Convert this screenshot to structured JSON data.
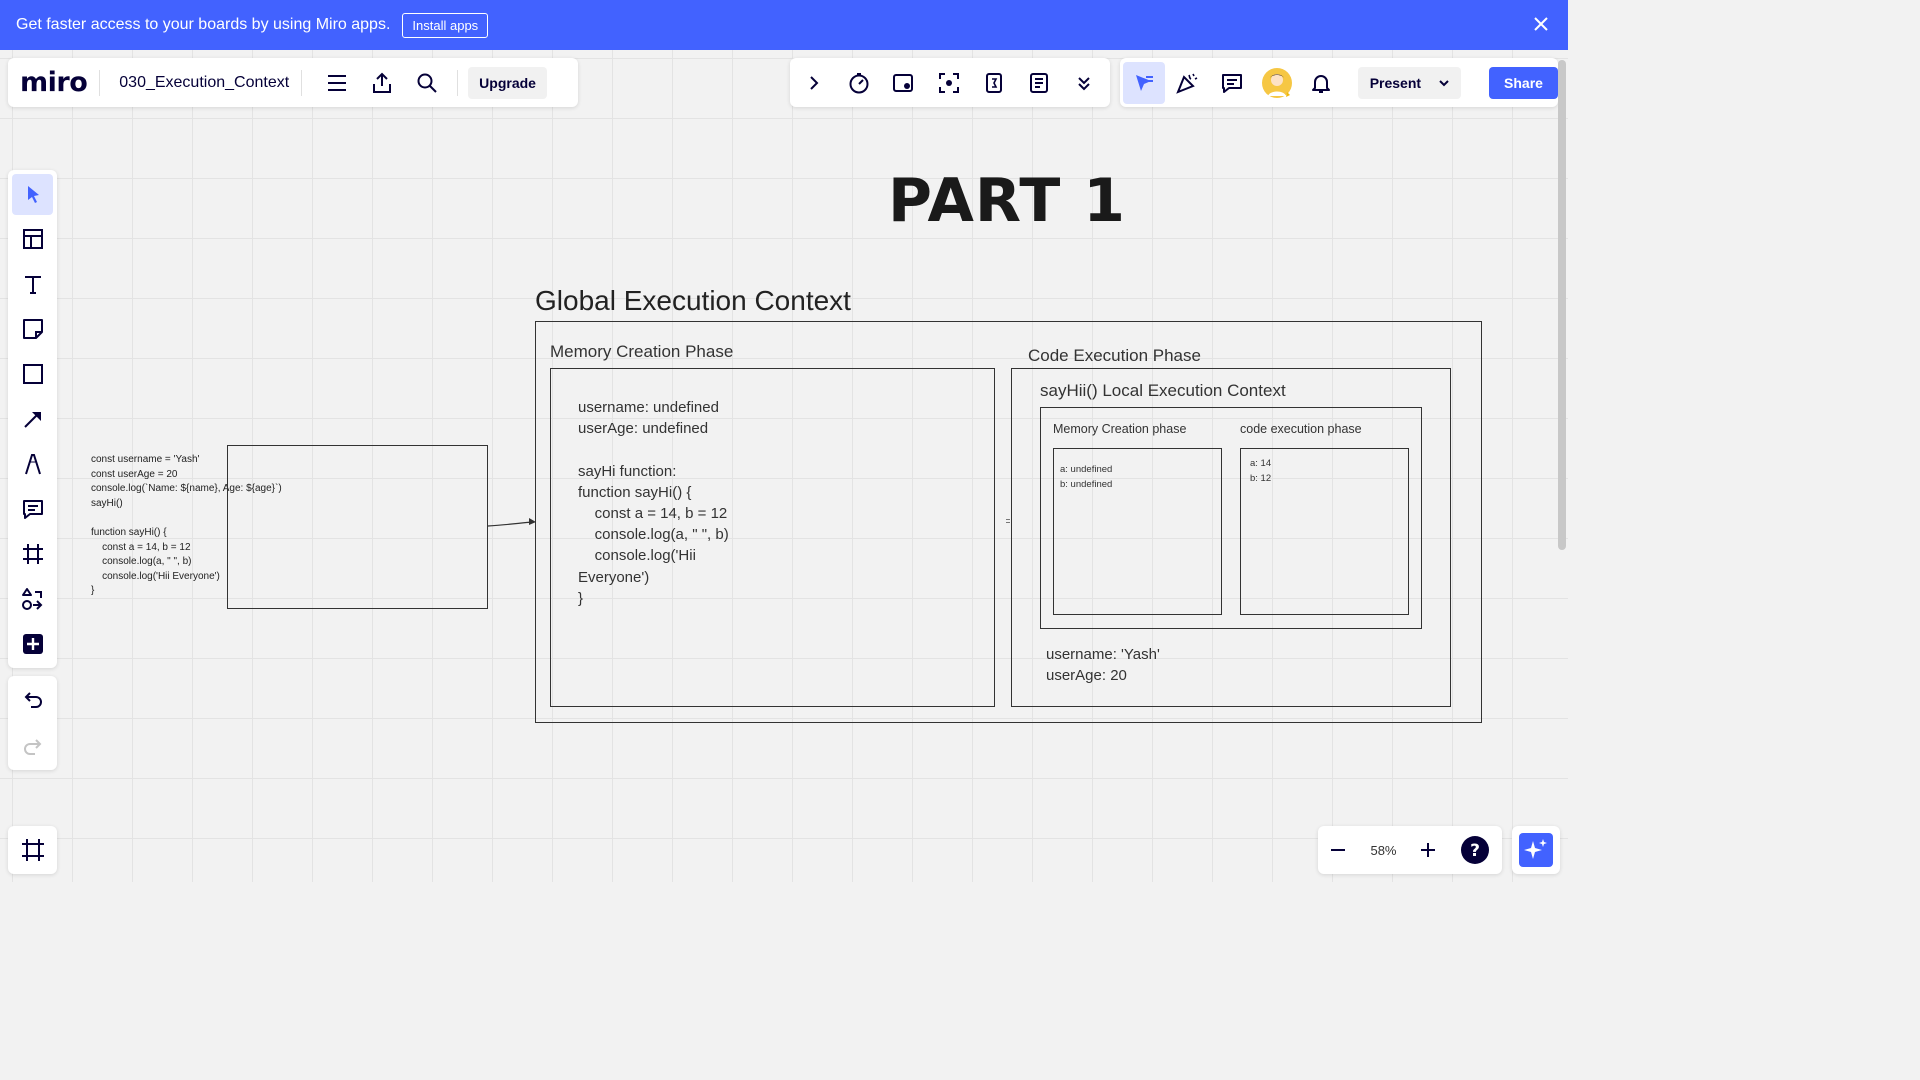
{
  "banner": {
    "message": "Get faster access to your boards by using Miro apps.",
    "install_label": "Install apps"
  },
  "header": {
    "logo": "miro",
    "board_name": "030_Execution_Context",
    "upgrade_label": "Upgrade",
    "present_label": "Present",
    "share_label": "Share"
  },
  "zoom": {
    "level": "58%"
  },
  "board": {
    "title": "PART 1",
    "gec_title": "Global Execution Context",
    "memory_phase_label": "Memory Creation Phase",
    "code_phase_label": "Code Execution Phase",
    "memory_phase_text": "username: undefined\nuserAge: undefined\n\nsayHi function:\nfunction sayHi() {\n    const a = 14, b = 12\n    console.log(a, \" \", b)\n    console.log('Hii\nEveryone')\n}",
    "local_ec_title": "sayHii() Local Execution Context",
    "local_memory_label": "Memory Creation phase",
    "local_code_label": "code execution phase",
    "local_memory_text": "a: undefined\nb: undefined",
    "local_code_text": "a: 14\nb: 12",
    "global_values_text": "username: 'Yash'\nuserAge: 20",
    "source_code": "const username = 'Yash'\nconst userAge = 20\nconsole.log(`Name: ${name}, Age: ${age}`)\nsayHi()\n\nfunction sayHi() {\n    const a = 14, b = 12\n    console.log(a, \" \", b)\n    console.log('Hii Everyone')\n}"
  },
  "colors": {
    "banner": "#4262ff",
    "share": "#4262ff",
    "active_tool": "#dde3ff"
  }
}
